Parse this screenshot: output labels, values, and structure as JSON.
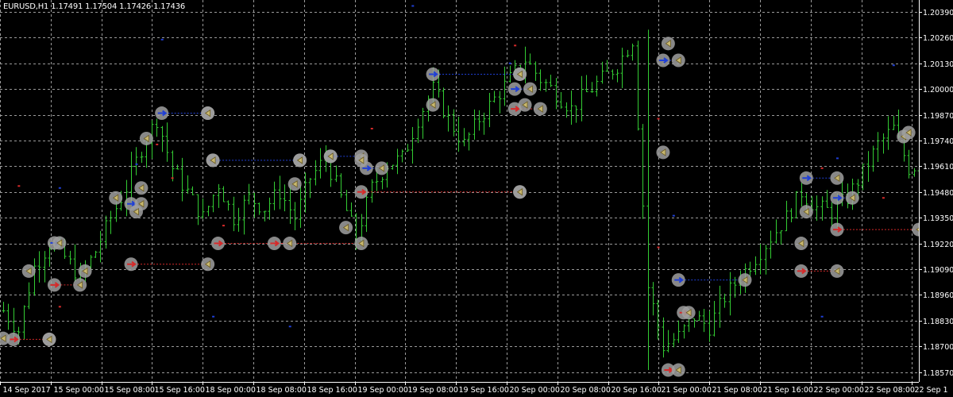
{
  "header": {
    "symbol": "EURUSD,H1",
    "open": "1.17491",
    "high": "1.17504",
    "low": "1.17426",
    "close": "1.17436"
  },
  "colors": {
    "background": "#000000",
    "grid": "#9a9a9a",
    "bar": "#33cc33",
    "buy_line": "#1f3fd6",
    "sell_line": "#d62a2a",
    "marker": "#a0a0a0",
    "close_arrow": "#c8b870",
    "axis_text": "#ffffff"
  },
  "chart_data": {
    "type": "ohlc",
    "grid": true,
    "y_ticks": [
      "1.20390",
      "1.20260",
      "1.20130",
      "1.20000",
      "1.19870",
      "1.19740",
      "1.19610",
      "1.19480",
      "1.19350",
      "1.19220",
      "1.19090",
      "1.18960",
      "1.18830",
      "1.18700",
      "1.18570"
    ],
    "x_ticks": [
      "14 Sep 2017",
      "15 Sep 00:00",
      "15 Sep 08:00",
      "15 Sep 16:00",
      "18 Sep 00:00",
      "18 Sep 08:00",
      "18 Sep 16:00",
      "19 Sep 00:00",
      "19 Sep 08:00",
      "19 Sep 16:00",
      "20 Sep 00:00",
      "20 Sep 08:00",
      "20 Sep 16:00",
      "21 Sep 00:00",
      "21 Sep 08:00",
      "21 Sep 16:00",
      "22 Sep 00:00",
      "22 Sep 08:00",
      "22 Sep 1"
    ],
    "ylim": [
      1.1852,
      1.2045
    ],
    "price_path": [
      [
        0,
        1.1888
      ],
      [
        3,
        1.1878
      ],
      [
        6,
        1.191
      ],
      [
        9,
        1.1922
      ],
      [
        12,
        1.1915
      ],
      [
        15,
        1.1905
      ],
      [
        18,
        1.1918
      ],
      [
        21,
        1.1935
      ],
      [
        24,
        1.195
      ],
      [
        27,
        1.197
      ],
      [
        30,
        1.1985
      ],
      [
        33,
        1.196
      ],
      [
        36,
        1.1948
      ],
      [
        39,
        1.1935
      ],
      [
        42,
        1.1952
      ],
      [
        45,
        1.1935
      ],
      [
        48,
        1.1945
      ],
      [
        51,
        1.194
      ],
      [
        54,
        1.1948
      ],
      [
        57,
        1.1935
      ],
      [
        60,
        1.1955
      ],
      [
        63,
        1.1965
      ],
      [
        66,
        1.1945
      ],
      [
        69,
        1.1925
      ],
      [
        72,
        1.195
      ],
      [
        75,
        1.1962
      ],
      [
        78,
        1.1965
      ],
      [
        81,
        1.1985
      ],
      [
        84,
        1.2
      ],
      [
        87,
        1.1985
      ],
      [
        90,
        1.1972
      ],
      [
        93,
        1.1985
      ],
      [
        96,
        1.1995
      ],
      [
        99,
        1.2005
      ],
      [
        102,
        1.2015
      ],
      [
        105,
        1.2005
      ],
      [
        108,
        1.1998
      ],
      [
        111,
        1.199
      ],
      [
        114,
        1.1998
      ],
      [
        117,
        1.2005
      ],
      [
        120,
        1.2012
      ],
      [
        123,
        1.2025
      ],
      [
        126,
        1.19
      ],
      [
        129,
        1.187
      ],
      [
        132,
        1.1875
      ],
      [
        135,
        1.1885
      ],
      [
        138,
        1.188
      ],
      [
        141,
        1.1895
      ],
      [
        144,
        1.1905
      ],
      [
        147,
        1.1915
      ],
      [
        150,
        1.1925
      ],
      [
        153,
        1.1935
      ],
      [
        156,
        1.1948
      ],
      [
        159,
        1.194
      ],
      [
        162,
        1.1938
      ],
      [
        165,
        1.1945
      ],
      [
        168,
        1.1958
      ],
      [
        171,
        1.1972
      ],
      [
        174,
        1.198
      ],
      [
        177,
        1.196
      ],
      [
        179,
        1.1962
      ]
    ],
    "trades": [
      {
        "type": "sell",
        "open": [
          2,
          1.18735
        ],
        "close": [
          9,
          1.18735
        ]
      },
      {
        "type": "sell",
        "open": [
          10,
          1.1901
        ],
        "close": [
          15,
          1.1901
        ]
      },
      {
        "type": "buy",
        "open": [
          10,
          1.19222
        ],
        "close": [
          11,
          1.19222
        ]
      },
      {
        "type": "sell",
        "open": [
          25,
          1.19115
        ],
        "close": [
          40,
          1.19115
        ]
      },
      {
        "type": "buy",
        "open": [
          25,
          1.1942
        ],
        "close": [
          27,
          1.1942
        ]
      },
      {
        "type": "buy",
        "open": [
          31,
          1.19878
        ],
        "close": [
          40,
          1.19878
        ]
      },
      {
        "type": "buy",
        "open": [
          41,
          1.1964
        ],
        "close": [
          58,
          1.1964
        ]
      },
      {
        "type": "sell",
        "open": [
          42,
          1.1922
        ],
        "close": [
          70,
          1.1922
        ]
      },
      {
        "type": "sell",
        "open": [
          53,
          1.1922
        ],
        "close": [
          56,
          1.1922
        ]
      },
      {
        "type": "buy",
        "open": [
          64,
          1.1966
        ],
        "close": [
          70,
          1.1966
        ]
      },
      {
        "type": "buy",
        "open": [
          71,
          1.196
        ],
        "close": [
          74,
          1.196
        ]
      },
      {
        "type": "sell",
        "open": [
          70,
          1.1948
        ],
        "close": [
          101,
          1.1948
        ]
      },
      {
        "type": "buy",
        "open": [
          84,
          1.20075
        ],
        "close": [
          101,
          1.20075
        ]
      },
      {
        "type": "buy",
        "open": [
          100,
          1.2
        ],
        "close": [
          103,
          1.2
        ]
      },
      {
        "type": "sell",
        "open": [
          100,
          1.199
        ],
        "close": [
          105,
          1.199
        ]
      },
      {
        "type": "buy",
        "open": [
          129,
          1.20145
        ],
        "close": [
          132,
          1.20145
        ]
      },
      {
        "type": "sell",
        "open": [
          130,
          1.1858
        ],
        "close": [
          132,
          1.1858
        ]
      },
      {
        "type": "buy",
        "open": [
          132,
          1.19035
        ],
        "close": [
          145,
          1.19035
        ]
      },
      {
        "type": "sell",
        "open": [
          133,
          1.1887
        ],
        "close": [
          134,
          1.1887
        ]
      },
      {
        "type": "buy",
        "open": [
          157,
          1.1955
        ],
        "close": [
          163,
          1.1955
        ]
      },
      {
        "type": "sell",
        "open": [
          156,
          1.1908
        ],
        "close": [
          163,
          1.1908
        ]
      },
      {
        "type": "buy",
        "open": [
          163,
          1.1945
        ],
        "close": [
          166,
          1.1945
        ]
      },
      {
        "type": "sell",
        "open": [
          163,
          1.1929
        ],
        "close": [
          179,
          1.1929
        ]
      }
    ],
    "entry_markers": [
      [
        0,
        1.1874
      ],
      [
        9,
        1.18735
      ],
      [
        5,
        1.1908
      ],
      [
        16,
        1.1908
      ],
      [
        26,
        1.1938
      ],
      [
        27,
        1.195
      ],
      [
        28,
        1.1975
      ],
      [
        22,
        1.1945
      ],
      [
        40,
        1.19878
      ],
      [
        41,
        1.1964
      ],
      [
        57,
        1.1952
      ],
      [
        58,
        1.1964
      ],
      [
        64,
        1.1966
      ],
      [
        67,
        1.193
      ],
      [
        70,
        1.1964
      ],
      [
        84,
        1.1992
      ],
      [
        101,
        1.20075
      ],
      [
        102,
        1.1992
      ],
      [
        130,
        1.2023
      ],
      [
        129,
        1.1968
      ],
      [
        156,
        1.1922
      ],
      [
        157,
        1.1938
      ],
      [
        176,
        1.1976
      ],
      [
        177,
        1.1978
      ],
      [
        101,
        1.1948
      ]
    ],
    "stray_dots": {
      "red": [
        [
          3,
          1.1951
        ],
        [
          11,
          1.189
        ],
        [
          30,
          1.1972
        ],
        [
          33,
          1.1955
        ],
        [
          43,
          1.1931
        ],
        [
          72,
          1.198
        ],
        [
          100,
          1.2022
        ],
        [
          128,
          1.1985
        ],
        [
          128,
          1.192
        ],
        [
          160,
          1.196
        ],
        [
          172,
          1.1945
        ]
      ],
      "blue": [
        [
          11,
          1.195
        ],
        [
          26,
          1.1962
        ],
        [
          31,
          1.2025
        ],
        [
          41,
          1.1885
        ],
        [
          56,
          1.188
        ],
        [
          80,
          1.2042
        ],
        [
          99,
          1.2013
        ],
        [
          100,
          1.2055
        ],
        [
          131,
          1.1936
        ],
        [
          160,
          1.1885
        ],
        [
          163,
          1.1965
        ],
        [
          174,
          1.2012
        ]
      ]
    }
  }
}
